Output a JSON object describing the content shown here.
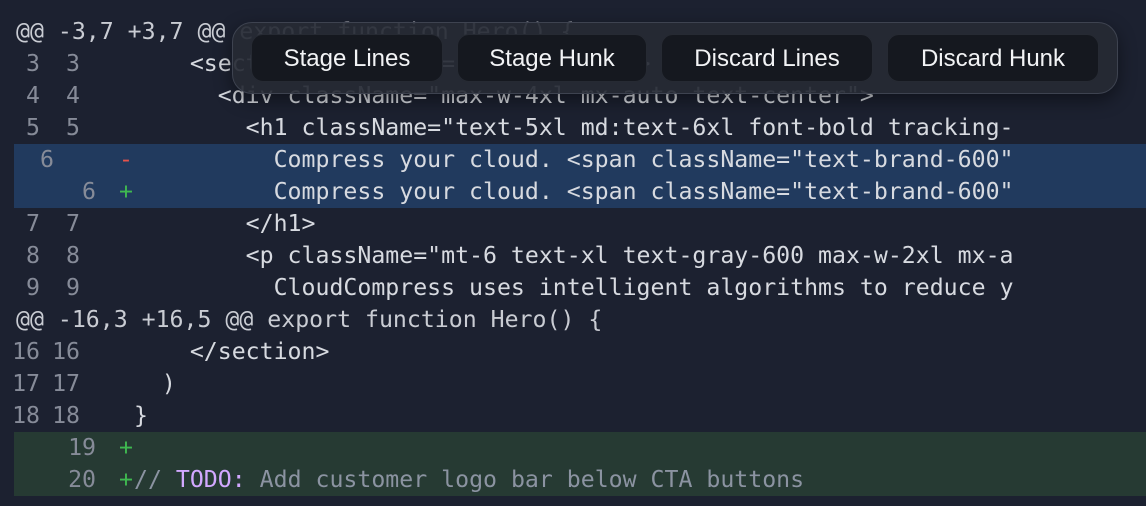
{
  "toolbar": {
    "stage_lines": "Stage Lines",
    "stage_hunk": "Stage Hunk",
    "discard_lines": "Discard Lines",
    "discard_hunk": "Discard Hunk"
  },
  "hunks": [
    {
      "header": "@@ -3,7 +3,7 @@ export function Hero() {",
      "lines": [
        {
          "old": "3",
          "new": "3",
          "sign": "",
          "code": "    <section className=\"pt-20 pb-16\">"
        },
        {
          "old": "4",
          "new": "4",
          "sign": "",
          "code": "      <div className=\"max-w-4xl mx-auto text-center\">"
        },
        {
          "old": "5",
          "new": "5",
          "sign": "",
          "code": "        <h1 className=\"text-5xl md:text-6xl font-bold tracking-"
        },
        {
          "old": "6",
          "new": "",
          "sign": "-",
          "code": "          Compress your cloud. <span className=\"text-brand-600\""
        },
        {
          "old": "",
          "new": "6",
          "sign": "+",
          "code": "          Compress your cloud. <span className=\"text-brand-600\""
        },
        {
          "old": "7",
          "new": "7",
          "sign": "",
          "code": "        </h1>"
        },
        {
          "old": "8",
          "new": "8",
          "sign": "",
          "code": "        <p className=\"mt-6 text-xl text-gray-600 max-w-2xl mx-a"
        },
        {
          "old": "9",
          "new": "9",
          "sign": "",
          "code": "          CloudCompress uses intelligent algorithms to reduce y"
        }
      ]
    },
    {
      "header": "@@ -16,3 +16,5 @@ export function Hero() {",
      "lines": [
        {
          "old": "16",
          "new": "16",
          "sign": "",
          "code": "    </section>"
        },
        {
          "old": "17",
          "new": "17",
          "sign": "",
          "code": "  )"
        },
        {
          "old": "18",
          "new": "18",
          "sign": "",
          "code": "}"
        },
        {
          "old": "",
          "new": "19",
          "sign": "+",
          "code": ""
        },
        {
          "old": "",
          "new": "20",
          "sign": "+",
          "code_prefix": "// ",
          "code_keyword": "TODO:",
          "code_rest": " Add customer logo bar below CTA buttons"
        }
      ]
    }
  ]
}
